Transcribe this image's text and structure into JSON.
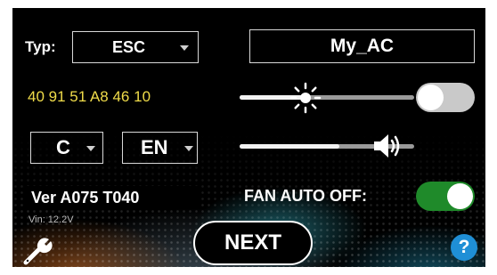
{
  "typ": {
    "label": "Typ:",
    "value": "ESC"
  },
  "device_name": "My_AC",
  "address": "40 91 51 A8 46 10",
  "brightness": {
    "icon": "sun-icon",
    "level": 0.38
  },
  "volume": {
    "icon": "speaker-icon",
    "level": 0.57
  },
  "toggle_top": {
    "state": "off"
  },
  "unit_select": {
    "value": "C"
  },
  "lang_select": {
    "value": "EN"
  },
  "version": "Ver A075 T040",
  "voltage": "Vin: 12.2V",
  "fan_auto_off": {
    "label": "FAN AUTO OFF:",
    "state": "on"
  },
  "next_label": "NEXT",
  "icons": {
    "settings": "wrench-icon",
    "help": "help-icon",
    "help_glyph": "?"
  },
  "colors": {
    "address": "#f0dc4a",
    "toggle_on": "#1f8a2a",
    "toggle_off": "#c9c9c9",
    "help": "#1f8fd6"
  }
}
